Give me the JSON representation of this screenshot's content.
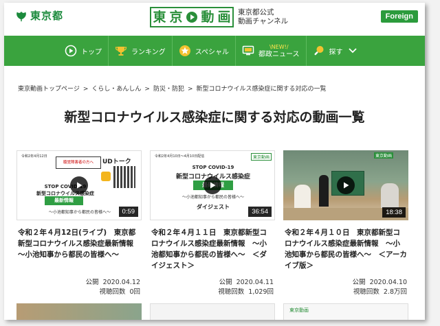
{
  "header": {
    "metro_name": "東京都",
    "brand_chars": [
      "東",
      "京",
      "動",
      "画"
    ],
    "brand_sub_line1": "東京都公式",
    "brand_sub_line2": "動画チャンネル",
    "foreign_label": "Foreign"
  },
  "nav": {
    "items": [
      {
        "label": "トップ",
        "icon": "play-circle-icon"
      },
      {
        "label": "ランキング",
        "icon": "trophy-icon"
      },
      {
        "label": "スペシャル",
        "icon": "star-badge-icon"
      },
      {
        "label": "都政ニュース",
        "badge": "\\NEW!/",
        "icon": "monitor-icon"
      },
      {
        "label": "探す",
        "icon": "search-icon"
      }
    ]
  },
  "breadcrumb": [
    "東京動画トップページ",
    "くらし・あんしん",
    "防災・防犯",
    "新型コロナウイルス感染症に関する対応の一覧"
  ],
  "breadcrumb_sep": ">",
  "page_title": "新型コロナウイルス感染症に関する対応の動画一覧",
  "meta_labels": {
    "published": "公開",
    "views": "視聴回数"
  },
  "videos": [
    {
      "title": "令和２年４月12日(ライブ)　東京都新型コロナウイルス感染症最新情報　～小池知事から都民の皆様へ～",
      "duration": "0:59",
      "published": "2020.04.12",
      "views": "0回",
      "thumb": {
        "date": "令和2年4月12日",
        "notice": "聴覚障害者の方へ",
        "ud": "UDトーク",
        "l1": "STOP COVID-19",
        "l2": "新型コロナウイルス感染症",
        "badge": "最新情報",
        "sub": "～小池都知事から都民の皆様へ～"
      }
    },
    {
      "title": "令和２年４月１１日　東京都新型コロナウイルス感染症最新情報　～小池都知事から都民の皆様へ～　＜ダイジェスト＞",
      "duration": "36:54",
      "published": "2020.04.11",
      "views": "1,029回",
      "thumb": {
        "date": "令和2年4月10日～4月10日配信",
        "l1": "STOP COVID-19",
        "l2": "新型コロナウイルス感染症",
        "badge": "最新情報",
        "sub": "～小池都知事から都民の皆様へ～",
        "digest": "ダイジェスト",
        "logo": "東京動画"
      }
    },
    {
      "title": "令和２年４月１０日　東京都新型コロナウイルス感染症最新情報　～小池知事から都民の皆様へ～　＜アーカイブ版＞",
      "duration": "18:38",
      "published": "2020.04.10",
      "views": "2.8万回",
      "thumb": {
        "logo": "東京動画"
      }
    }
  ],
  "colors": {
    "brand_green": "#2a8f3a",
    "nav_green": "#3aa33e",
    "new_yellow": "#ffe44d"
  }
}
